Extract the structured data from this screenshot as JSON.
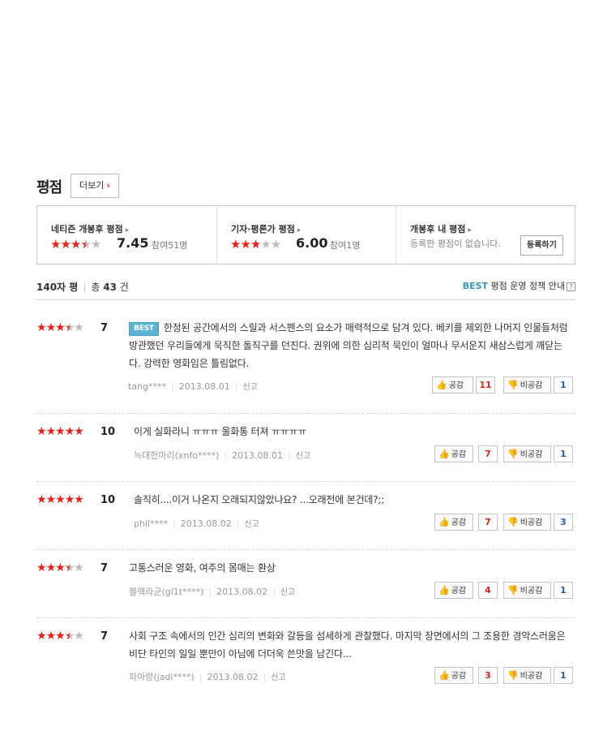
{
  "section": {
    "title": "평점",
    "more_label": "더보기"
  },
  "score_box": {
    "netizen": {
      "title": "네티즌 개봉후 평점",
      "score": "7.45",
      "participants": "참여51명",
      "stars": [
        1,
        1,
        1,
        0.5,
        0
      ]
    },
    "critic": {
      "title": "기자·평론가 평점",
      "score": "6.00",
      "participants": "참여1명",
      "stars": [
        1,
        1,
        1,
        0,
        0
      ]
    },
    "mine": {
      "title": "개봉후 내 평점",
      "note": "등록한 평점이 없습니다.",
      "register_label": "등록하기"
    }
  },
  "summary": {
    "limit_label": "140자 평",
    "total_prefix": "총",
    "total_count": "43",
    "total_suffix": "건",
    "best_label": "BEST",
    "policy_label": "평점 운영 정책 안내",
    "help_icon": "?"
  },
  "reviews": [
    {
      "stars": [
        1,
        1,
        1,
        0.5,
        0
      ],
      "score": "7",
      "best": true,
      "best_label": "BEST",
      "text": "한정된 공간에서의 스릴과 서스펜스의 요소가 매력적으로 담겨 있다. 베키를 제외한 나머지 인물들처럼 방관했던 우리들에게 묵직한 돌직구를 던진다. 권위에 의한 심리적 묵인이 얼마나 무서운지 새삼스럽게 깨닫는다. 강력한 영화임은 틀림없다.",
      "author": "tang****",
      "date": "2013.08.01",
      "report": "신고",
      "like_label": "공감",
      "likes": "11",
      "dislike_label": "비공감",
      "dislikes": "1"
    },
    {
      "stars": [
        1,
        1,
        1,
        1,
        1
      ],
      "score": "10",
      "best": false,
      "text": "이게 실화라니 ㅠㅠㅠ 울화통 터져 ㅠㅠㅠㅠ",
      "author": "늑대한마리(xnfo****)",
      "date": "2013.08.01",
      "report": "신고",
      "like_label": "공감",
      "likes": "7",
      "dislike_label": "비공감",
      "dislikes": "1"
    },
    {
      "stars": [
        1,
        1,
        1,
        1,
        1
      ],
      "score": "10",
      "best": false,
      "text": "솔직히....이거 나온지 오래되지않았나요? ...오래전에 본건데?;;",
      "author": "phil****",
      "date": "2013.08.02",
      "report": "신고",
      "like_label": "공감",
      "likes": "7",
      "dislike_label": "비공감",
      "dislikes": "3"
    },
    {
      "stars": [
        1,
        1,
        1,
        0.5,
        0
      ],
      "score": "7",
      "best": false,
      "text": "고통스러운 영화, 여주의 몸매는 환상",
      "author": "블랙라군(gl1t****)",
      "date": "2013.08.02",
      "report": "신고",
      "like_label": "공감",
      "likes": "4",
      "dislike_label": "비공감",
      "dislikes": "1"
    },
    {
      "stars": [
        1,
        1,
        1,
        0.5,
        0
      ],
      "score": "7",
      "best": false,
      "text": "사회 구조 속에서의 인간 심리의 변화와 갈등을 섬세하게 관찰했다. 마지막 장면에서의 그 조용한 경악스러움은 비단 타인의 일일 뿐만이 아님에 더더욱 쓴맛을 남긴다...",
      "author": "파아랑(jadi****)",
      "date": "2013.08.02",
      "report": "신고",
      "like_label": "공감",
      "likes": "3",
      "dislike_label": "비공감",
      "dislikes": "1"
    }
  ],
  "colors": {
    "star_on": "#e2231a",
    "star_off": "#bdbdbd",
    "best_badge": "#5bb6d6",
    "like_count": "#d2261e",
    "dislike_count": "#2b5aa6"
  },
  "icons": {
    "star": "★",
    "like": "thumbs-up-icon",
    "dislike": "thumbs-down-icon"
  }
}
